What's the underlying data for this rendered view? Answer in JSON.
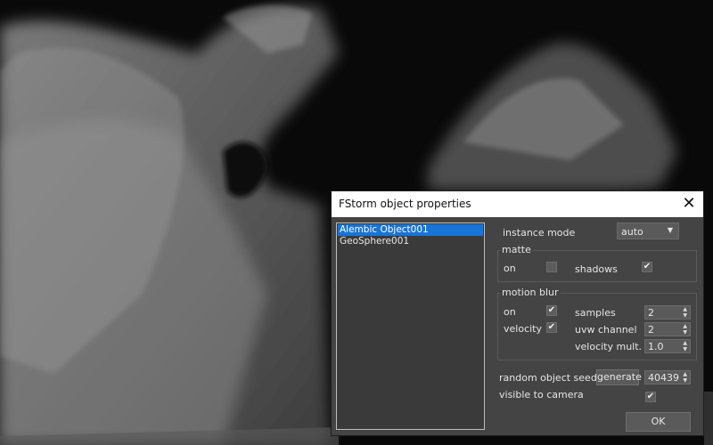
{
  "dialog": {
    "title": "FStorm object properties",
    "close_glyph": "✕",
    "objects": [
      "Alembic Object001",
      "GeoSphere001"
    ],
    "selected_index": 0,
    "instance_mode": {
      "label": "instance mode",
      "value": "auto",
      "arrow": "▼"
    },
    "matte": {
      "title": "matte",
      "on_label": "on",
      "on_checked": false,
      "shadows_label": "shadows",
      "shadows_checked": true
    },
    "motion_blur": {
      "title": "motion blur",
      "on_label": "on",
      "on_checked": true,
      "velocity_label": "velocity",
      "velocity_checked": true,
      "samples_label": "samples",
      "samples_value": "2",
      "uvw_label": "uvw channel",
      "uvw_value": "2",
      "vmult_label": "velocity mult.",
      "vmult_value": "1.0"
    },
    "seed": {
      "label": "random object seed",
      "generate_label": "generate",
      "value": "40439"
    },
    "visible": {
      "label": "visible to camera",
      "checked": true
    },
    "ok_label": "OK",
    "check_glyph": "✔",
    "spin_glyph": "▲\n▼"
  },
  "colors": {
    "selection": "#1874d6",
    "dialog_bg": "#444444",
    "titlebar": "#ffffff"
  },
  "icons": {
    "close": "close-icon",
    "dropdown": "chevron-down-icon"
  }
}
